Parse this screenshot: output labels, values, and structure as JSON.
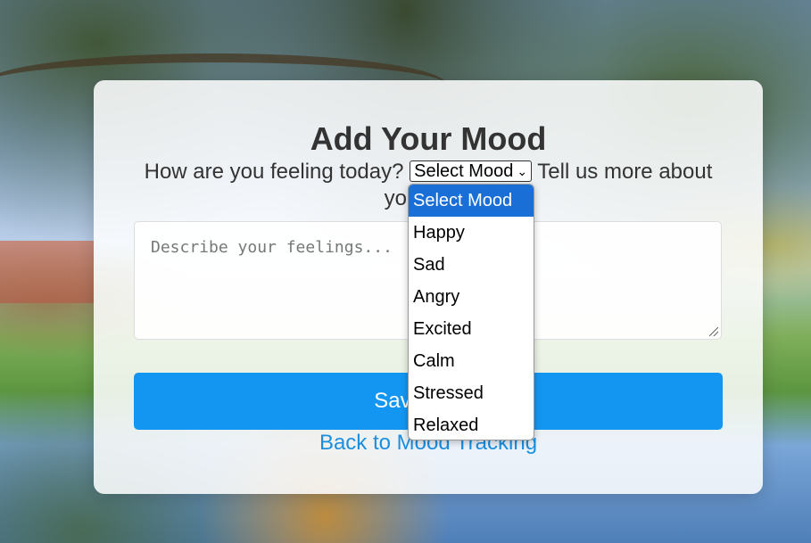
{
  "page": {
    "title": "Add Your Mood",
    "prompt_before": "How are you feeling today?",
    "prompt_after": "Tell us more about your day:",
    "mood_select": {
      "selected": "Select Mood",
      "options": [
        "Select Mood",
        "Happy",
        "Sad",
        "Angry",
        "Excited",
        "Calm",
        "Stressed",
        "Relaxed"
      ]
    },
    "description_placeholder": "Describe your feelings...",
    "save_label": "Save Mood",
    "back_link_label": "Back to Mood Tracking"
  },
  "colors": {
    "button_blue": "#1396f2",
    "link_blue": "#1a8fe0",
    "option_highlight": "#1a6fd6"
  }
}
